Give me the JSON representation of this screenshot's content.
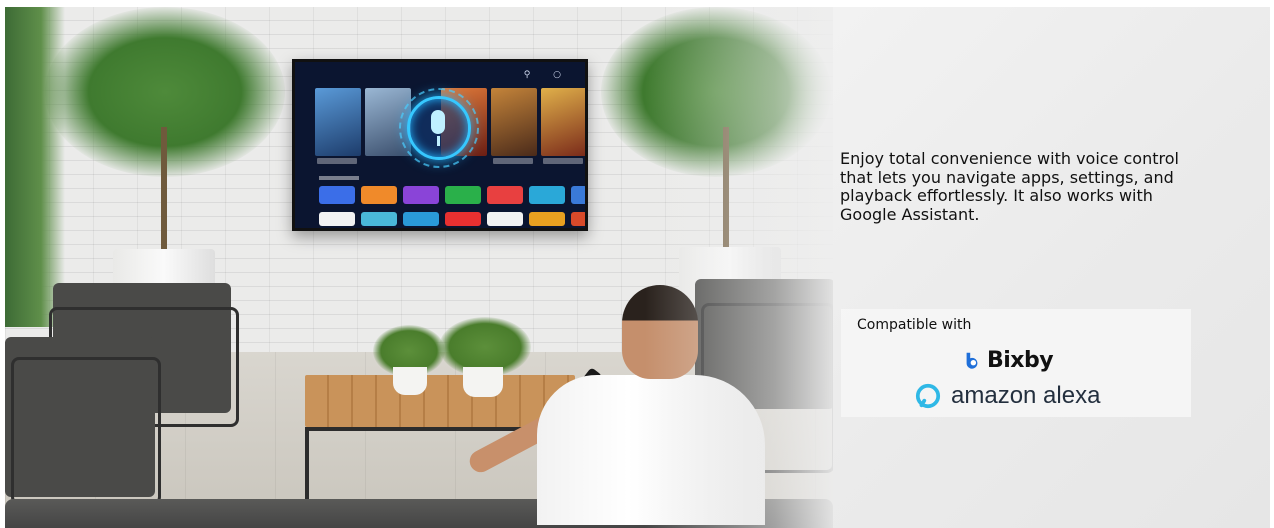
{
  "description": "Enjoy total convenience with voice control that lets you navigate apps, settings, and playback effortlessly. It also works with Google Assistant.",
  "compatibility": {
    "title": "Compatible with",
    "brands": [
      {
        "name": "Bixby",
        "icon": "bixby-icon",
        "color": "#1f6fd9"
      },
      {
        "name": "amazon alexa",
        "icon": "alexa-ring-icon",
        "color": "#2fb8e6"
      }
    ]
  },
  "scene": {
    "icons": [
      "search-icon",
      "settings-icon",
      "microphone-icon"
    ],
    "tv_screen": {
      "accent": "#36c8ff"
    }
  }
}
